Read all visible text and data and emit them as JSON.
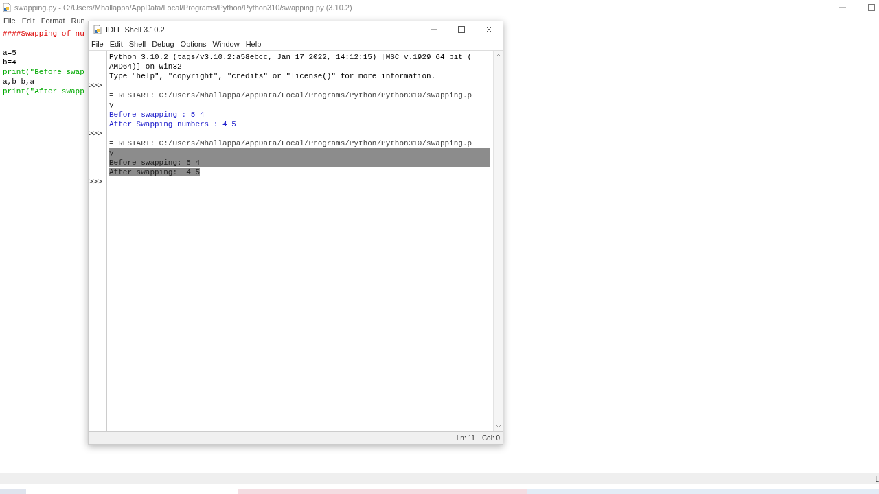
{
  "editor": {
    "title": "swapping.py - C:/Users/Mhallappa/AppData/Local/Programs/Python/Python310/swapping.py (3.10.2)",
    "menu": [
      "File",
      "Edit",
      "Format",
      "Run"
    ],
    "code": [
      {
        "text": "####Swapping of nu",
        "kind": "comment"
      },
      {
        "kind": "blank"
      },
      {
        "text": "a=5",
        "kind": "plain"
      },
      {
        "text": "b=4",
        "kind": "plain"
      },
      {
        "text": "print(\"Before swap",
        "kind": "string"
      },
      {
        "text": "a,b=b,a",
        "kind": "plain"
      },
      {
        "text": "print(\"After swapp",
        "kind": "string"
      }
    ],
    "status": "L"
  },
  "shell": {
    "title": "IDLE Shell 3.10.2",
    "menu": [
      "File",
      "Edit",
      "Shell",
      "Debug",
      "Options",
      "Window",
      "Help"
    ],
    "lines": [
      {
        "text": "Python 3.10.2 (tags/v3.10.2:a58ebcc, Jan 17 2022, 14:12:15) [MSC v.1929 64 bit (",
        "kind": "output",
        "selected": false
      },
      {
        "text": "AMD64)] on win32",
        "kind": "output",
        "selected": false
      },
      {
        "text": "Type \"help\", \"copyright\", \"credits\" or \"license()\" for more information.",
        "kind": "output",
        "selected": false
      },
      {
        "prompt": ">>>",
        "kind": "prompt"
      },
      {
        "text": "= RESTART: C:/Users/Mhallappa/AppData/Local/Programs/Python/Python310/swapping.p",
        "kind": "restart",
        "selected": false
      },
      {
        "text": "y",
        "kind": "output",
        "selected": false
      },
      {
        "text": "Before swapping : 5 4",
        "kind": "stdout",
        "selected": false
      },
      {
        "text": "After Swapping numbers : 4 5",
        "kind": "stdout",
        "selected": false
      },
      {
        "prompt": ">>>",
        "kind": "prompt"
      },
      {
        "text": "= RESTART: C:/Users/Mhallappa/AppData/Local/Programs/Python/Python310/swapping.p",
        "kind": "restart",
        "selected": false
      },
      {
        "text": "y",
        "kind": "output",
        "selected": true
      },
      {
        "text": "Before swapping: 5 4",
        "kind": "stdout",
        "selected": true
      },
      {
        "text": "After swapping:  4 5",
        "kind": "stdout",
        "selected": true
      },
      {
        "prompt": ">>>",
        "kind": "prompt"
      }
    ],
    "status": {
      "line": "Ln: 11",
      "col": "Col: 0"
    }
  }
}
